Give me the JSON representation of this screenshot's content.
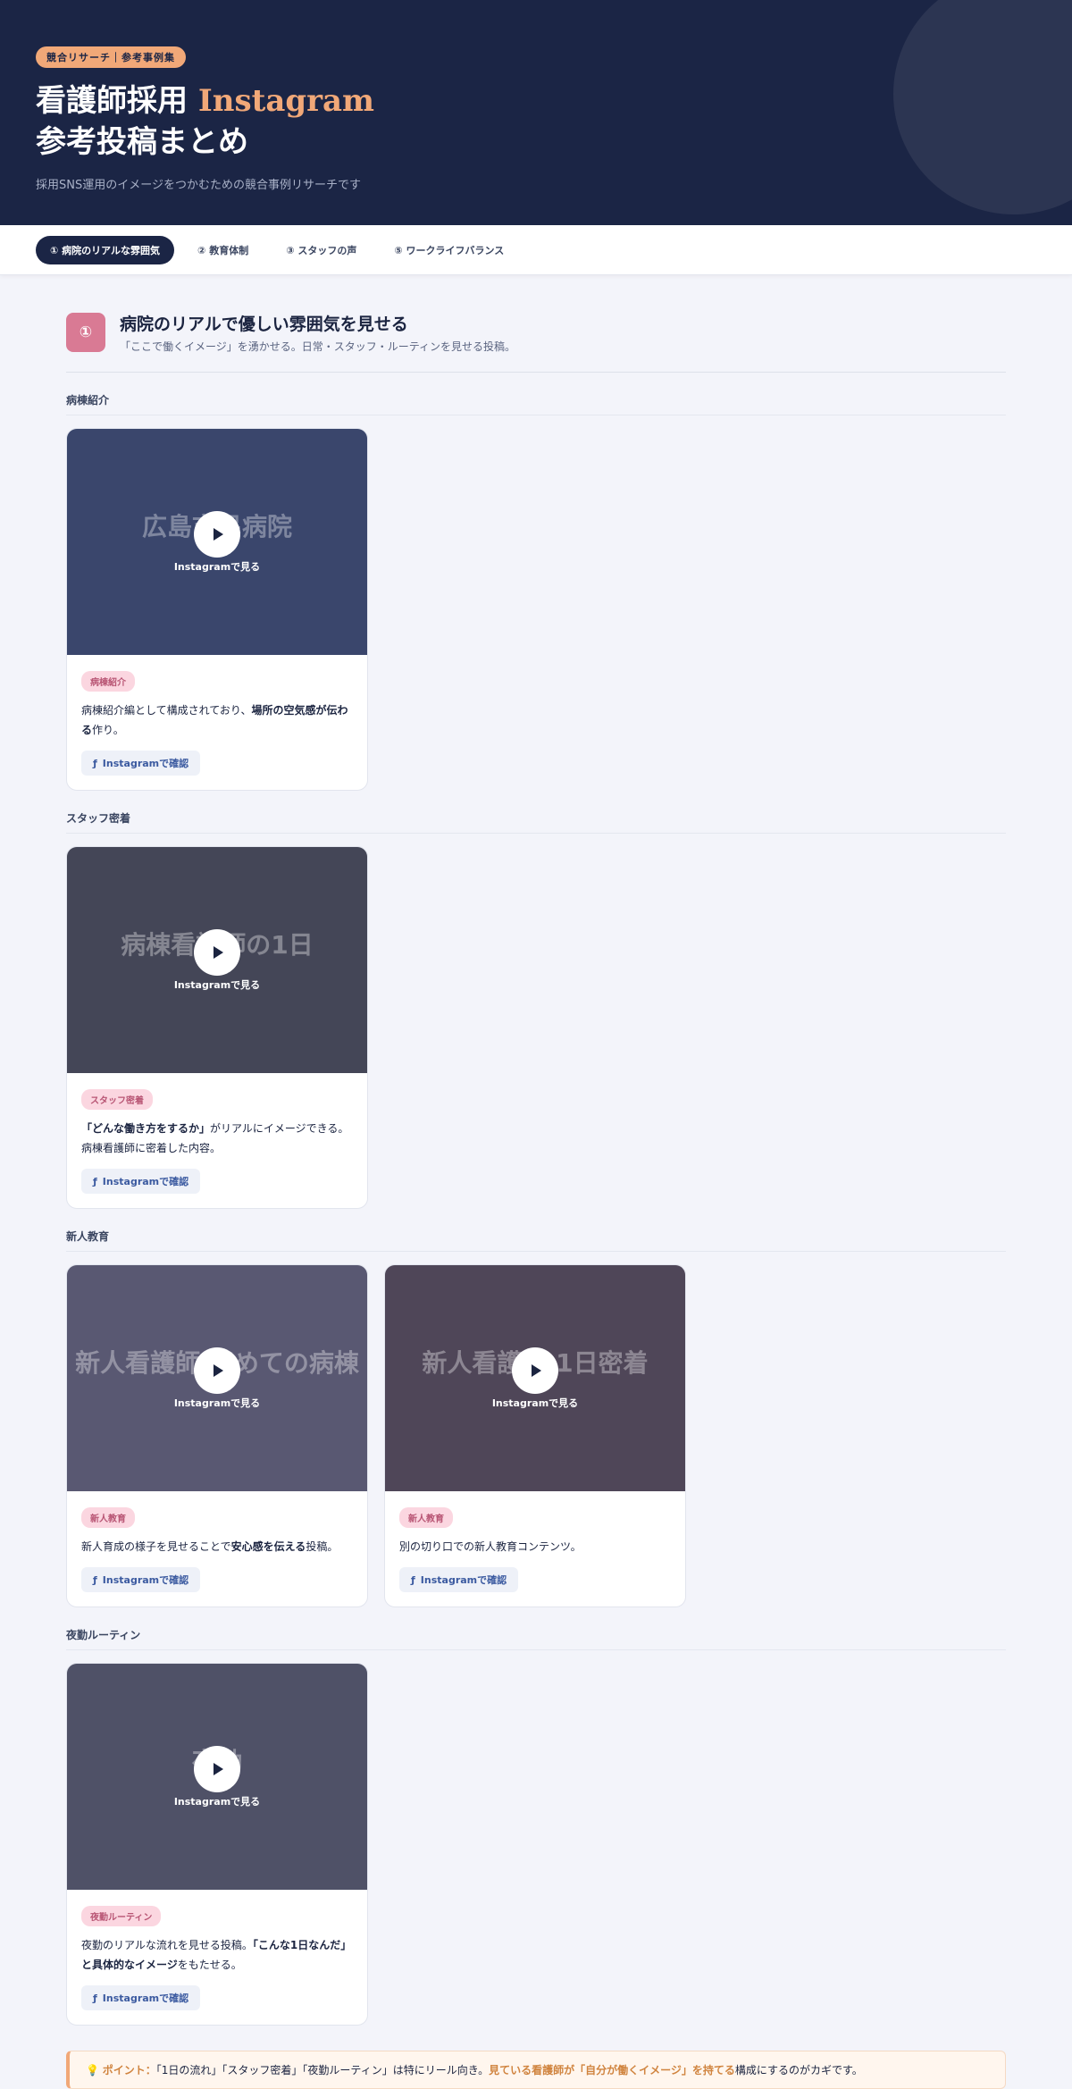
{
  "header": {
    "tag": "競合リサーチ｜参考事例集",
    "title_line1": "看護師採用 ",
    "title_accent": "Instagram",
    "title_line2": "参考投稿まとめ",
    "subtitle": "採用SNS運用のイメージをつかむための競合事例リサーチです"
  },
  "tabs": [
    {
      "label": "① 病院のリアルな雰囲気",
      "active": true
    },
    {
      "label": "② 教育体制"
    },
    {
      "label": "③ スタッフの声"
    },
    {
      "label": "⑤ ワークライフバランス"
    }
  ],
  "section": {
    "number": "①",
    "title": "病院のリアルで優しい雰囲気を見せる",
    "desc": "「ここで働くイメージ」を湧かせる。日常・スタッフ・ルーティンを見せる投稿。"
  },
  "common": {
    "play_label": "Instagramで見る",
    "ig_button": "Instagramで確認"
  },
  "groups": [
    {
      "label": "病棟紹介",
      "cards": [
        {
          "tag": "病棟紹介",
          "thumb_text": "広島市民病院",
          "text_pre": "病棟紹介編として構成されており、",
          "text_bold": "場所の空気感が伝わる",
          "text_post": "作り。",
          "color": "#4a5a86"
        }
      ]
    },
    {
      "label": "スタッフ密着",
      "cards": [
        {
          "tag": "スタッフ密着",
          "thumb_text": "病棟看護師の1日",
          "text_pre": "",
          "text_bold": "「どんな働き方をするか」",
          "text_post": "がリアルにイメージできる。病棟看護師に密着した内容。",
          "color": "#5a5a66"
        }
      ]
    },
    {
      "label": "新人教育",
      "cards": [
        {
          "tag": "新人教育",
          "thumb_text": "新人看護師 初めての病棟",
          "text_pre": "新人育成の様子を見せることで",
          "text_bold": "安心感を伝える",
          "text_post": "投稿。",
          "color": "#7a7690"
        },
        {
          "tag": "新人教育",
          "thumb_text": "新人看護師 1日密着",
          "text_pre": "別の切り口での新人教育コンテンツ。",
          "text_bold": "",
          "text_post": "",
          "color": "#6a5a68"
        }
      ]
    },
    {
      "label": "夜勤ルーティン",
      "cards": [
        {
          "tag": "夜勤ルーティン",
          "thumb_text": "夜勤",
          "text_pre": "夜勤のリアルな流れを見せる投稿。",
          "text_bold": "「こんな1日なんだ」と具体的なイメージ",
          "text_post": "をもたせる。",
          "color": "#6a6a7e"
        }
      ]
    }
  ],
  "point": {
    "label": "ポイント：",
    "text1": "「1日の流れ」「スタッフ密着」「夜勤ルーティン」は特にリール向き。",
    "highlight": "見ている看護師が「自分が働くイメージ」を持てる",
    "text2": "構成にするのがカギです。"
  }
}
